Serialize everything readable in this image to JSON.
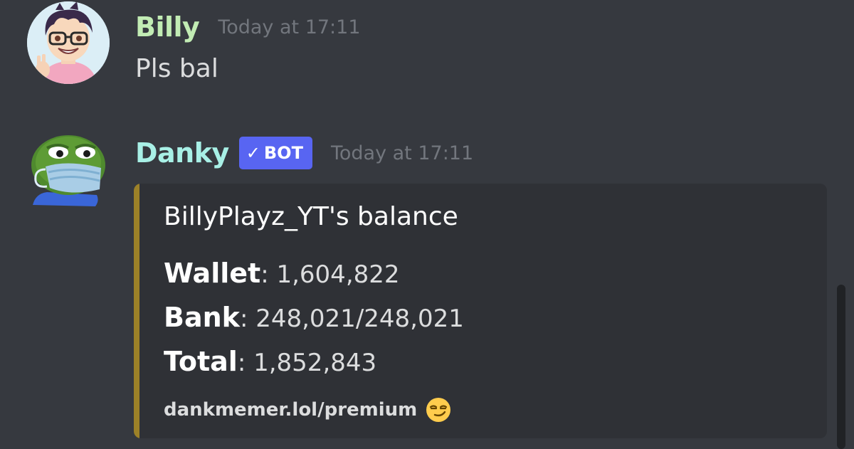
{
  "messages": [
    {
      "author": "Billy",
      "timestamp": "Today at 17:11",
      "content": "Pls bal",
      "author_color": "#c2ecb4"
    },
    {
      "author": "Danky",
      "bot_tag": "BOT",
      "timestamp": "Today at 17:11",
      "author_color": "#a8f0e6",
      "embed": {
        "title": "BillyPlayz_YT's balance",
        "accent_color": "#9c8128",
        "fields": [
          {
            "name": "Wallet",
            "separator": ":",
            "value": " 1,604,822"
          },
          {
            "name": "Bank",
            "separator": ":",
            "value": " 248,021/248,021"
          },
          {
            "name": "Total",
            "separator": ":",
            "value": " 1,852,843"
          }
        ],
        "footer": "dankmemer.lol/premium",
        "footer_emoji": "smirking-face-emoji"
      }
    }
  ],
  "icons": {
    "billy_avatar": "cartoon-boy-avatar",
    "danky_avatar": "pepe-frog-mask-avatar",
    "verified": "checkmark-icon"
  }
}
